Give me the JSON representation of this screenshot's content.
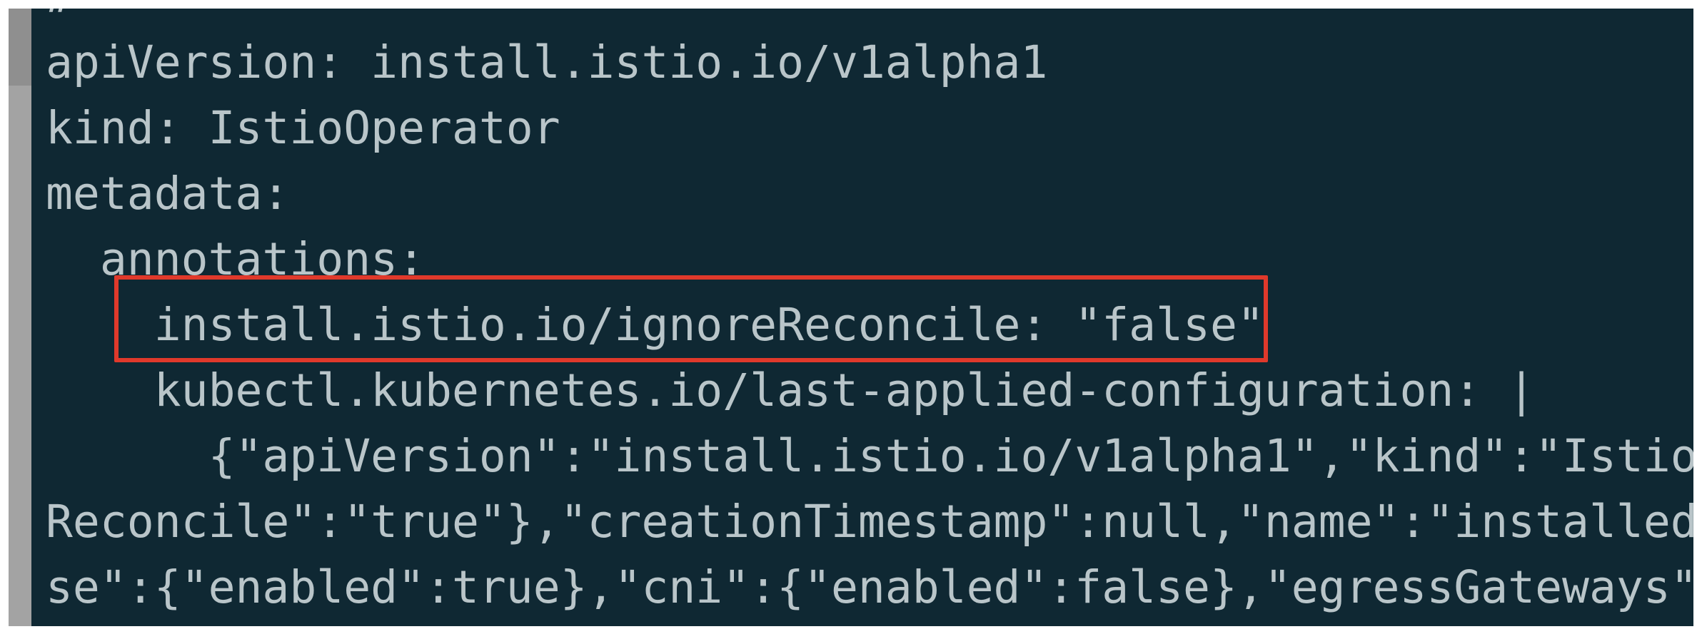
{
  "editor": {
    "lines": [
      {
        "text": "#",
        "indent": ""
      },
      {
        "text": "apiVersion: install.istio.io/v1alpha1",
        "indent": ""
      },
      {
        "text": "kind: IstioOperator",
        "indent": ""
      },
      {
        "text": "metadata:",
        "indent": ""
      },
      {
        "text": "annotations:",
        "indent": "  "
      },
      {
        "text": "install.istio.io/ignoreReconcile: \"false\"",
        "indent": "    "
      },
      {
        "text": "kubectl.kubernetes.io/last-applied-configuration: |",
        "indent": "    "
      },
      {
        "text": "{\"apiVersion\":\"install.istio.io/v1alpha1\",\"kind\":\"Istio",
        "indent": "      "
      },
      {
        "text": "Reconcile\":\"true\"},\"creationTimestamp\":null,\"name\":\"installed",
        "indent": ""
      },
      {
        "text": "se\":{\"enabled\":true},\"cni\":{\"enabled\":false},\"egressGateways\"",
        "indent": ""
      }
    ],
    "highlighted_line_index": 5,
    "colors": {
      "background": "#0f2833",
      "text": "#b9c5c9",
      "highlight_border": "#e0392b",
      "gutter": "#a3a3a3"
    }
  }
}
